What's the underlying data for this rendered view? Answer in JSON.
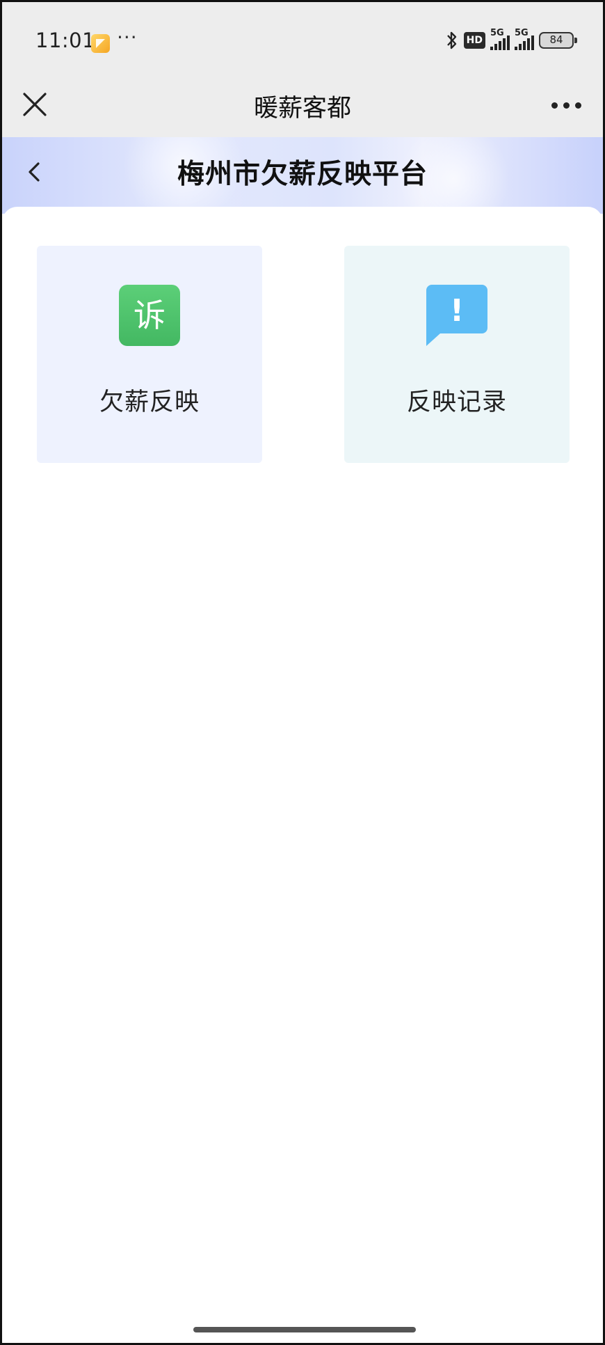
{
  "status_bar": {
    "time": "11:01",
    "more": "···",
    "hd": "HD",
    "sim1_label": "5G",
    "sim2_label": "5G",
    "battery": "84"
  },
  "nav": {
    "title": "暖薪客都"
  },
  "header": {
    "title": "梅州市欠薪反映平台"
  },
  "tiles": [
    {
      "label": "欠薪反映",
      "icon_text": "诉",
      "icon": "complaint-icon",
      "icon_color": "#4cc46a",
      "background": "#eef2fe"
    },
    {
      "label": "反映记录",
      "icon_text": "!",
      "icon": "chat-alert-icon",
      "icon_color": "#5cbcf5",
      "background": "#ecf6f8"
    }
  ]
}
